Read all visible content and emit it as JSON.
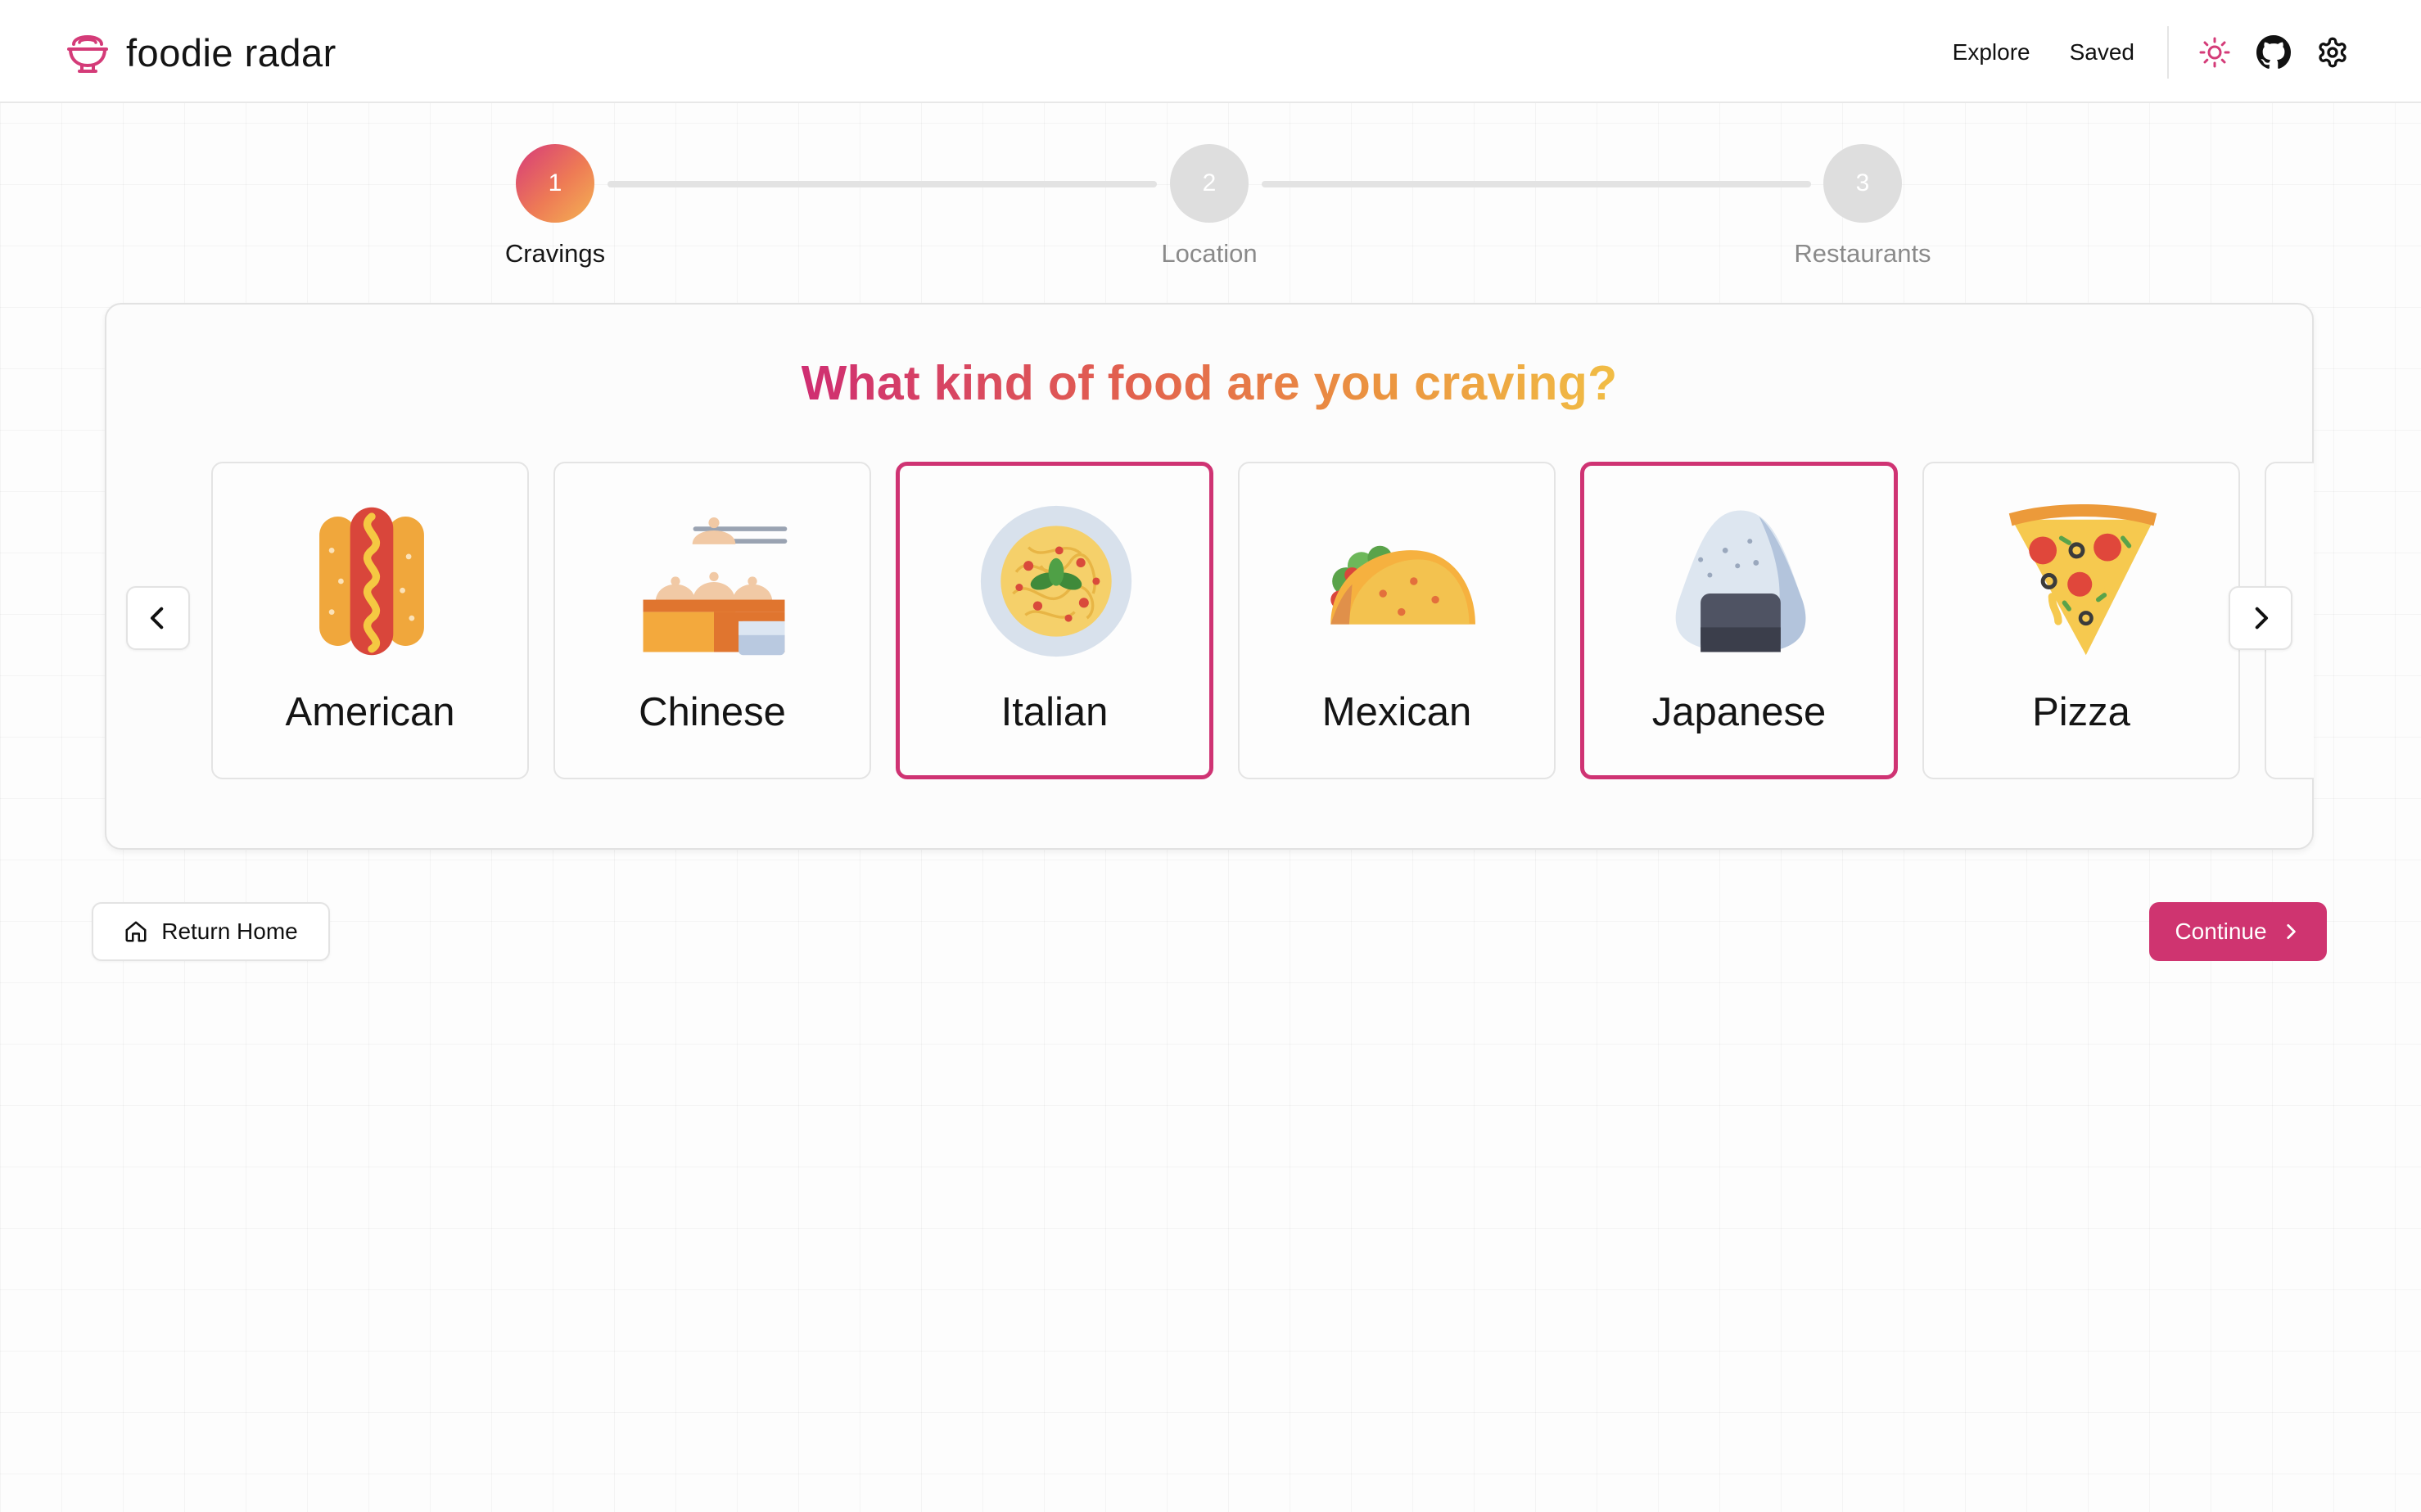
{
  "app": {
    "brand": "foodie radar",
    "brand_color": "#cf3470"
  },
  "nav": {
    "links": [
      "Explore",
      "Saved"
    ],
    "icons": [
      "sun-icon",
      "github-icon",
      "gear-icon"
    ]
  },
  "stepper": {
    "steps": [
      {
        "number": "1",
        "label": "Cravings",
        "state": "active"
      },
      {
        "number": "2",
        "label": "Location",
        "state": "inactive"
      },
      {
        "number": "3",
        "label": "Restaurants",
        "state": "inactive"
      }
    ]
  },
  "main": {
    "heading": "What kind of food are you craving?",
    "heading_gradient": [
      "#cf2e72",
      "#e2614f",
      "#eb9340",
      "#f1bd45"
    ],
    "cuisines": [
      {
        "label": "American",
        "icon": "hot-dog-icon",
        "selected": false
      },
      {
        "label": "Chinese",
        "icon": "dumplings-icon",
        "selected": false
      },
      {
        "label": "Italian",
        "icon": "spaghetti-icon",
        "selected": true
      },
      {
        "label": "Mexican",
        "icon": "taco-icon",
        "selected": false
      },
      {
        "label": "Japanese",
        "icon": "onigiri-icon",
        "selected": true
      },
      {
        "label": "Pizza",
        "icon": "pizza-icon",
        "selected": false
      }
    ],
    "prev_icon": "chevron-left-icon",
    "next_icon": "chevron-right-icon"
  },
  "actions": {
    "home_label": "Return Home",
    "continue_label": "Continue"
  }
}
